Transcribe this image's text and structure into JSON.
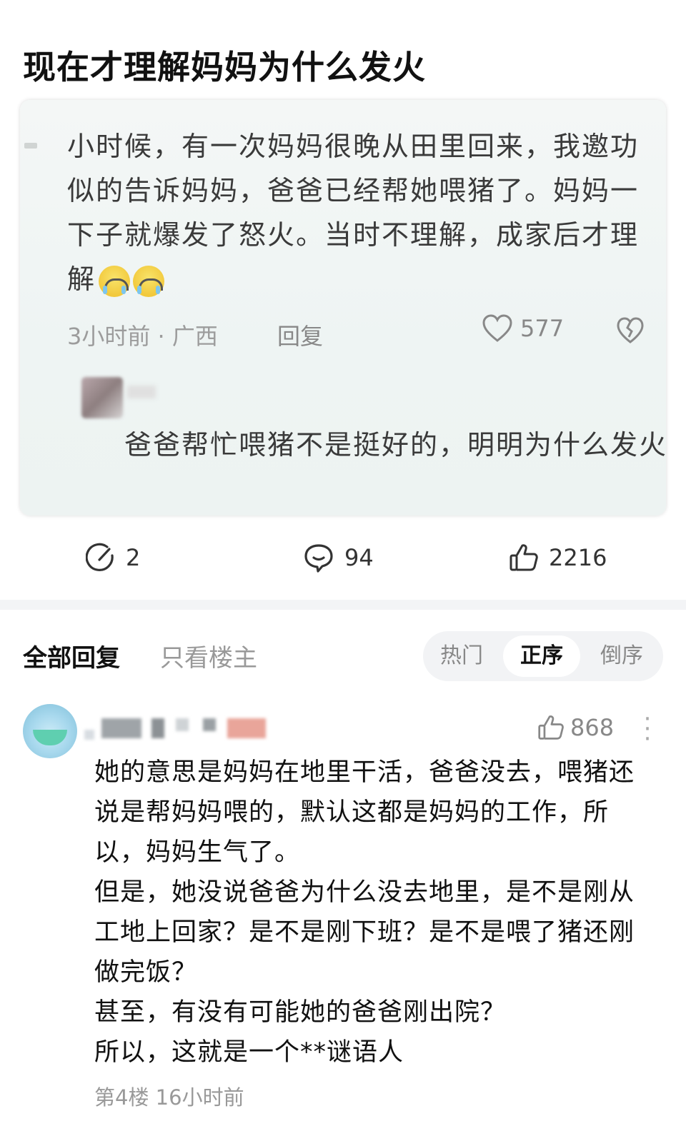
{
  "post": {
    "title": "现在才理解妈妈为什么发火"
  },
  "screenshot": {
    "original_comment": "小时候，有一次妈妈很晚从田里回来，我邀功似的告诉妈妈，爸爸已经帮她喂猪了。妈妈一下子就爆发了怒火。当时不理解，成家后才理解",
    "original_meta": {
      "time_location": "3小时前 · 广西",
      "reply_label": "回复",
      "likes": "577"
    },
    "reply_text": "爸爸帮忙喂猪不是挺好的，明明为什么发火"
  },
  "actions": {
    "share_count": "2",
    "comment_count": "94",
    "like_count": "2216"
  },
  "tabs": {
    "all_replies": "全部回复",
    "op_only": "只看楼主",
    "sort_options": [
      "热门",
      "正序",
      "倒序"
    ],
    "active_sort": "正序"
  },
  "comment": {
    "likes": "868",
    "paragraphs": [
      "她的意思是妈妈在地里干活，爸爸没去，喂猪还说是帮妈妈喂的，默认这都是妈妈的工作，所以，妈妈生气了。",
      "但是，她没说爸爸为什么没去地里，是不是刚从工地上回家？是不是刚下班？是不是喂了猪还刚做完饭？",
      "甚至，有没有可能她的爸爸刚出院？",
      "所以，这就是一个**谜语人"
    ],
    "floor": "第4楼",
    "time": "16小时前"
  },
  "icons": [
    "share-icon",
    "comment-icon",
    "thumbs-up-icon",
    "heart-icon",
    "dislike-heart-icon",
    "more-icon"
  ]
}
